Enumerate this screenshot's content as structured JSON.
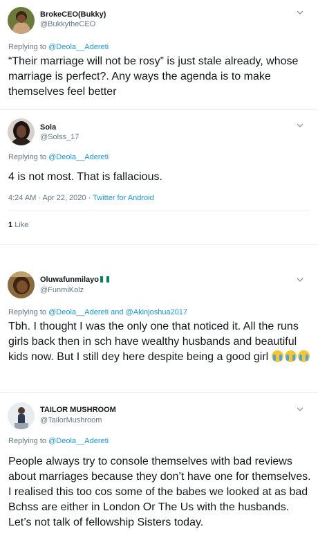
{
  "tweets": [
    {
      "name": "BrokeCEO(Bukky)",
      "handle": "@BukkytheCEO",
      "replying_prefix": "Replying to",
      "replying_to": "@Deola__Adereti",
      "text": "“Their marriage will not be rosy” is just stale already, whose marriage is perfect?. Any ways the agenda is to make themselves feel better"
    },
    {
      "name": "Sola",
      "handle": "@Solss_17",
      "replying_prefix": "Replying to",
      "replying_to": "@Deola__Adereti",
      "text": "4 is not most. That is fallacious.",
      "timestamp": "4:24 AM · Apr 22, 2020 · ",
      "source": "Twitter for Android",
      "like_count": "1",
      "like_label": "Like"
    },
    {
      "name": "Oluwafunmilayo",
      "handle": "@FunmiKolz",
      "replying_prefix": "Replying to",
      "replying_to": "@Deola__Adereti",
      "replying_and": "and",
      "replying_to_2": "@Akinjoshua2017",
      "text": "Tbh. I thought I was the only one that noticed it. All the runs girls back then in sch have wealthy husbands and beautiful kids now. But I still dey here despite being a good girl"
    },
    {
      "name": "TAILOR MUSHROOM",
      "handle": "@TailorMushroom",
      "replying_prefix": "Replying to",
      "replying_to": "@Deola__Adereti",
      "text": "People always try to console themselves with bad reviews about marriages because they don’t have one for themselves. I realised this too cos some of the babes we looked at as bad Bchss are either in London Or The Us with the husbands. Let’s not talk of fellowship Sisters today."
    }
  ],
  "colors": {
    "link": "#1b95e0",
    "muted": "#657786",
    "text": "#14171a",
    "divider": "#e6ecf0"
  },
  "icons": [
    "chevron-down-icon",
    "nigeria-flag-icon",
    "loudly-crying-face-icon"
  ]
}
